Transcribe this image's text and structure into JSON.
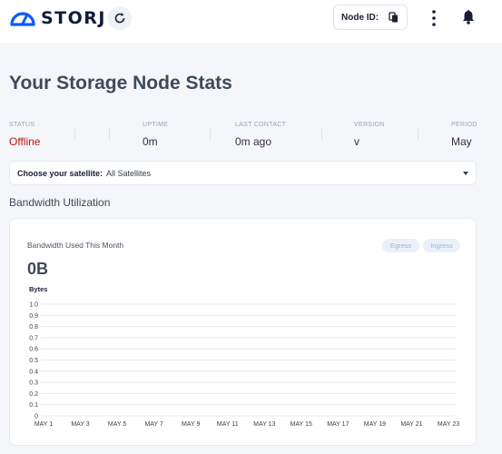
{
  "header": {
    "brand": "STORJ",
    "node_id_label": "Node ID:",
    "icons": [
      "storj-logo-icon",
      "refresh-icon",
      "copy-icon",
      "kebab-icon",
      "bell-icon"
    ],
    "accent": "#0b5bff"
  },
  "page_title": "Your Storage Node Stats",
  "stats": [
    {
      "label": "STATUS",
      "value": "Offline"
    },
    {
      "label": "UPTIME",
      "value": "0m"
    },
    {
      "label": "LAST CONTACT",
      "value": "0m ago"
    },
    {
      "label": "VERSION",
      "value": "v"
    },
    {
      "label": "PERIOD",
      "value": "May"
    }
  ],
  "status_color": "#c01212",
  "satellite": {
    "label": "Choose your satellite:",
    "value": "All Satellites"
  },
  "bandwidth": {
    "section_title": "Bandwidth Utilization",
    "card_title": "Bandwidth Used This Month",
    "egress_label": "Egress",
    "ingress_label": "Ingress",
    "total": "0B"
  },
  "chart_data": {
    "type": "line",
    "title": "",
    "ylabel": "Bytes",
    "xlabel": "",
    "ylim": [
      0,
      1.0
    ],
    "yticks": [
      "1.0",
      "0.9",
      "0.8",
      "0.7",
      "0.6",
      "0.5",
      "0.4",
      "0.3",
      "0.2",
      "0.1",
      "0"
    ],
    "x_ticks": [
      "MAY 1",
      "MAY 3",
      "MAY 5",
      "MAY 7",
      "MAY 9",
      "MAY 11",
      "MAY 13",
      "MAY 15",
      "MAY 17",
      "MAY 19",
      "MAY 21",
      "MAY 23"
    ],
    "grid": true,
    "series": []
  }
}
